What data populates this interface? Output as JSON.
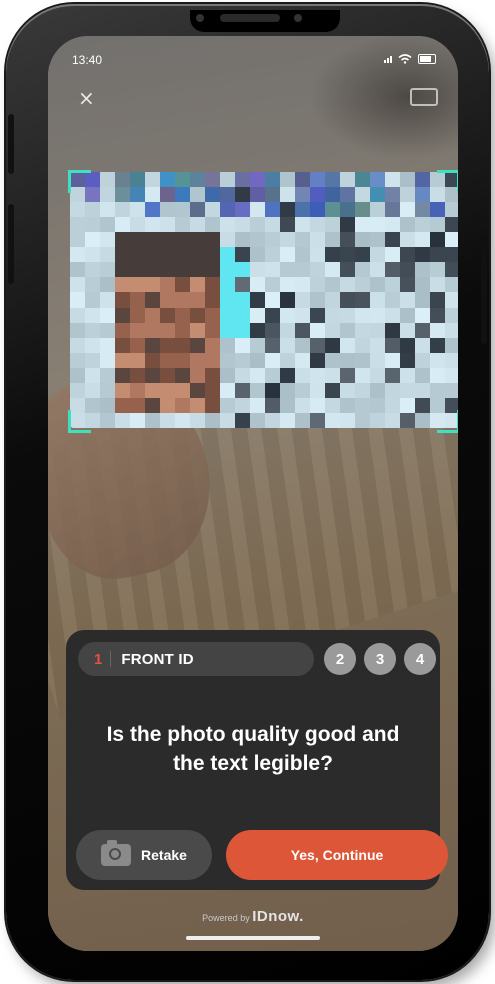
{
  "status": {
    "time": "13:40"
  },
  "header": {
    "close_icon": "×"
  },
  "step": {
    "number": "1",
    "label": "FRONT ID",
    "others": [
      "2",
      "3",
      "4"
    ]
  },
  "question": {
    "line1": "Is the photo quality good and",
    "line2": "the text legible?"
  },
  "actions": {
    "retake": "Retake",
    "continue": "Yes, Continue"
  },
  "footer": {
    "powered_prefix": "Powered by",
    "brand": "IDnow."
  },
  "colors": {
    "accent": "#dd5637",
    "frame": "#3fe0c0",
    "panel": "#2b2b2b"
  }
}
